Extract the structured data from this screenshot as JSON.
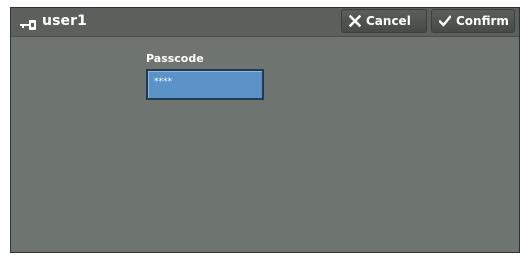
{
  "header": {
    "user_icon": "key-icon",
    "title": "user1",
    "cancel_label": "Cancel",
    "cancel_icon": "close-icon",
    "confirm_label": "Confirm",
    "confirm_icon": "checkmark-icon"
  },
  "form": {
    "passcode_label": "Passcode",
    "passcode_value": "****"
  },
  "colors": {
    "panel_bg": "#6e7470",
    "titlebar_bg": "#5b605c",
    "input_bg": "#5b92c8",
    "input_border": "#243a52"
  }
}
